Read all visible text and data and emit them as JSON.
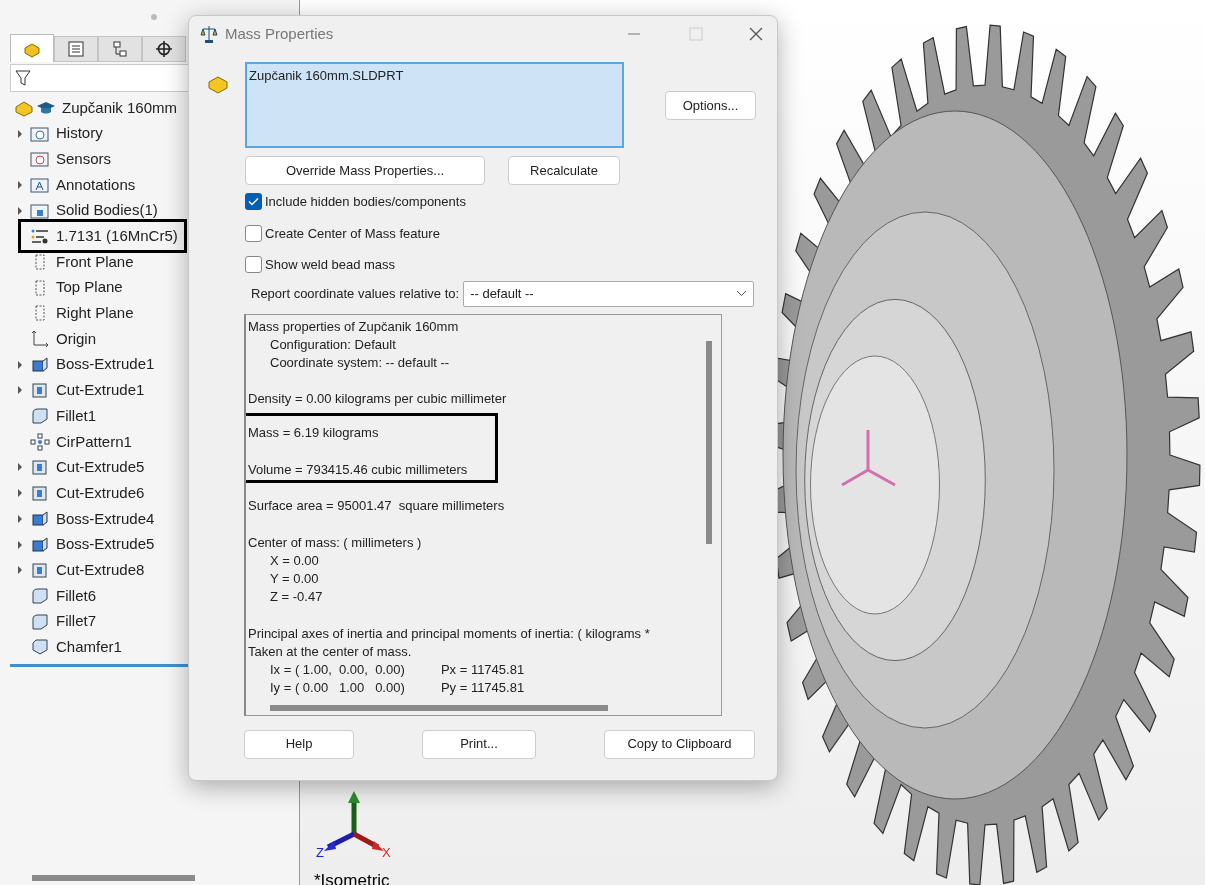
{
  "feature_tree": {
    "tabs": [
      {
        "kind": "features",
        "selected": true
      },
      {
        "kind": "properties",
        "selected": false
      },
      {
        "kind": "configurations",
        "selected": false
      },
      {
        "kind": "origin",
        "selected": false
      }
    ],
    "items": [
      {
        "label": "Zupčanik 160mm",
        "kind": "part",
        "expandable": false,
        "highlighted": false
      },
      {
        "label": "History",
        "kind": "history",
        "expandable": true,
        "highlighted": false
      },
      {
        "label": "Sensors",
        "kind": "sensors",
        "expandable": false,
        "highlighted": false
      },
      {
        "label": "Annotations",
        "kind": "annotations",
        "expandable": true,
        "highlighted": false
      },
      {
        "label": "Solid Bodies(1)",
        "kind": "bodies",
        "expandable": true,
        "highlighted": false
      },
      {
        "label": "1.7131 (16MnCr5)",
        "kind": "material",
        "expandable": false,
        "highlighted": true
      },
      {
        "label": "Front Plane",
        "kind": "plane",
        "expandable": false,
        "highlighted": false
      },
      {
        "label": "Top Plane",
        "kind": "plane",
        "expandable": false,
        "highlighted": false
      },
      {
        "label": "Right Plane",
        "kind": "plane",
        "expandable": false,
        "highlighted": false
      },
      {
        "label": "Origin",
        "kind": "origin",
        "expandable": false,
        "highlighted": false
      },
      {
        "label": "Boss-Extrude1",
        "kind": "boss",
        "expandable": true,
        "highlighted": false
      },
      {
        "label": "Cut-Extrude1",
        "kind": "cut",
        "expandable": true,
        "highlighted": false
      },
      {
        "label": "Fillet1",
        "kind": "fillet",
        "expandable": false,
        "highlighted": false
      },
      {
        "label": "CirPattern1",
        "kind": "pattern",
        "expandable": false,
        "highlighted": false
      },
      {
        "label": "Cut-Extrude5",
        "kind": "cut",
        "expandable": true,
        "highlighted": false
      },
      {
        "label": "Cut-Extrude6",
        "kind": "cut",
        "expandable": true,
        "highlighted": false
      },
      {
        "label": "Boss-Extrude4",
        "kind": "boss",
        "expandable": true,
        "highlighted": false
      },
      {
        "label": "Boss-Extrude5",
        "kind": "boss",
        "expandable": true,
        "highlighted": false
      },
      {
        "label": "Cut-Extrude8",
        "kind": "cut",
        "expandable": true,
        "highlighted": false
      },
      {
        "label": "Fillet6",
        "kind": "fillet",
        "expandable": false,
        "highlighted": false
      },
      {
        "label": "Fillet7",
        "kind": "fillet",
        "expandable": false,
        "highlighted": false
      },
      {
        "label": "Chamfer1",
        "kind": "chamfer",
        "expandable": false,
        "highlighted": false
      }
    ]
  },
  "viewport": {
    "triad_labels": [
      "Z",
      "X"
    ],
    "view_name": "*Isometric"
  },
  "dialog": {
    "title": "Mass Properties",
    "selection": "Zupčanik 160mm.SLDPRT",
    "options_button": "Options...",
    "override_button": "Override Mass Properties...",
    "recalculate_button": "Recalculate",
    "checkboxes": [
      {
        "label": "Include hidden bodies/components",
        "checked": true
      },
      {
        "label": "Create Center of Mass feature",
        "checked": false
      },
      {
        "label": "Show weld bead mass",
        "checked": false
      }
    ],
    "coordinate_label": "Report coordinate values relative to:",
    "coordinate_value": "-- default --",
    "report": [
      {
        "highlighted": false,
        "lines": [
          {
            "text": "Mass properties of Zupčanik 160mm",
            "indent": false,
            "gap_before": false
          },
          {
            "text": "Configuration: Default",
            "indent": true,
            "gap_before": false
          },
          {
            "text": "Coordinate system: -- default --",
            "indent": true,
            "gap_before": false
          },
          {
            "text": "Density = 0.00 kilograms per cubic millimeter",
            "indent": false,
            "gap_before": true
          }
        ]
      },
      {
        "highlighted": true,
        "lines": [
          {
            "text": "Mass = 6.19 kilograms",
            "indent": false,
            "gap_before": false
          },
          {
            "text": "Volume = 793415.46 cubic millimeters",
            "indent": false,
            "gap_before": true
          }
        ]
      },
      {
        "highlighted": false,
        "lines": [
          {
            "text": "Surface area = 95001.47  square millimeters",
            "indent": false,
            "gap_before": true
          },
          {
            "text": "Center of mass: ( millimeters )",
            "indent": false,
            "gap_before": true
          },
          {
            "text": "X = 0.00",
            "indent": true,
            "gap_before": false
          },
          {
            "text": "Y = 0.00",
            "indent": true,
            "gap_before": false
          },
          {
            "text": "Z = -0.47",
            "indent": true,
            "gap_before": false
          },
          {
            "text": "Principal axes of inertia and principal moments of inertia: ( kilograms *",
            "indent": false,
            "gap_before": true
          },
          {
            "text": "Taken at the center of mass.",
            "indent": false,
            "gap_before": false
          },
          {
            "text": "Ix = ( 1.00,  0.00,  0.00)          Px = 11745.81",
            "indent": true,
            "gap_before": false
          },
          {
            "text": "Iy = ( 0.00   1.00   0.00)          Py = 11745.81",
            "indent": true,
            "gap_before": false
          }
        ]
      }
    ],
    "footer_buttons": [
      "Help",
      "Print...",
      "Copy to Clipboard"
    ]
  }
}
